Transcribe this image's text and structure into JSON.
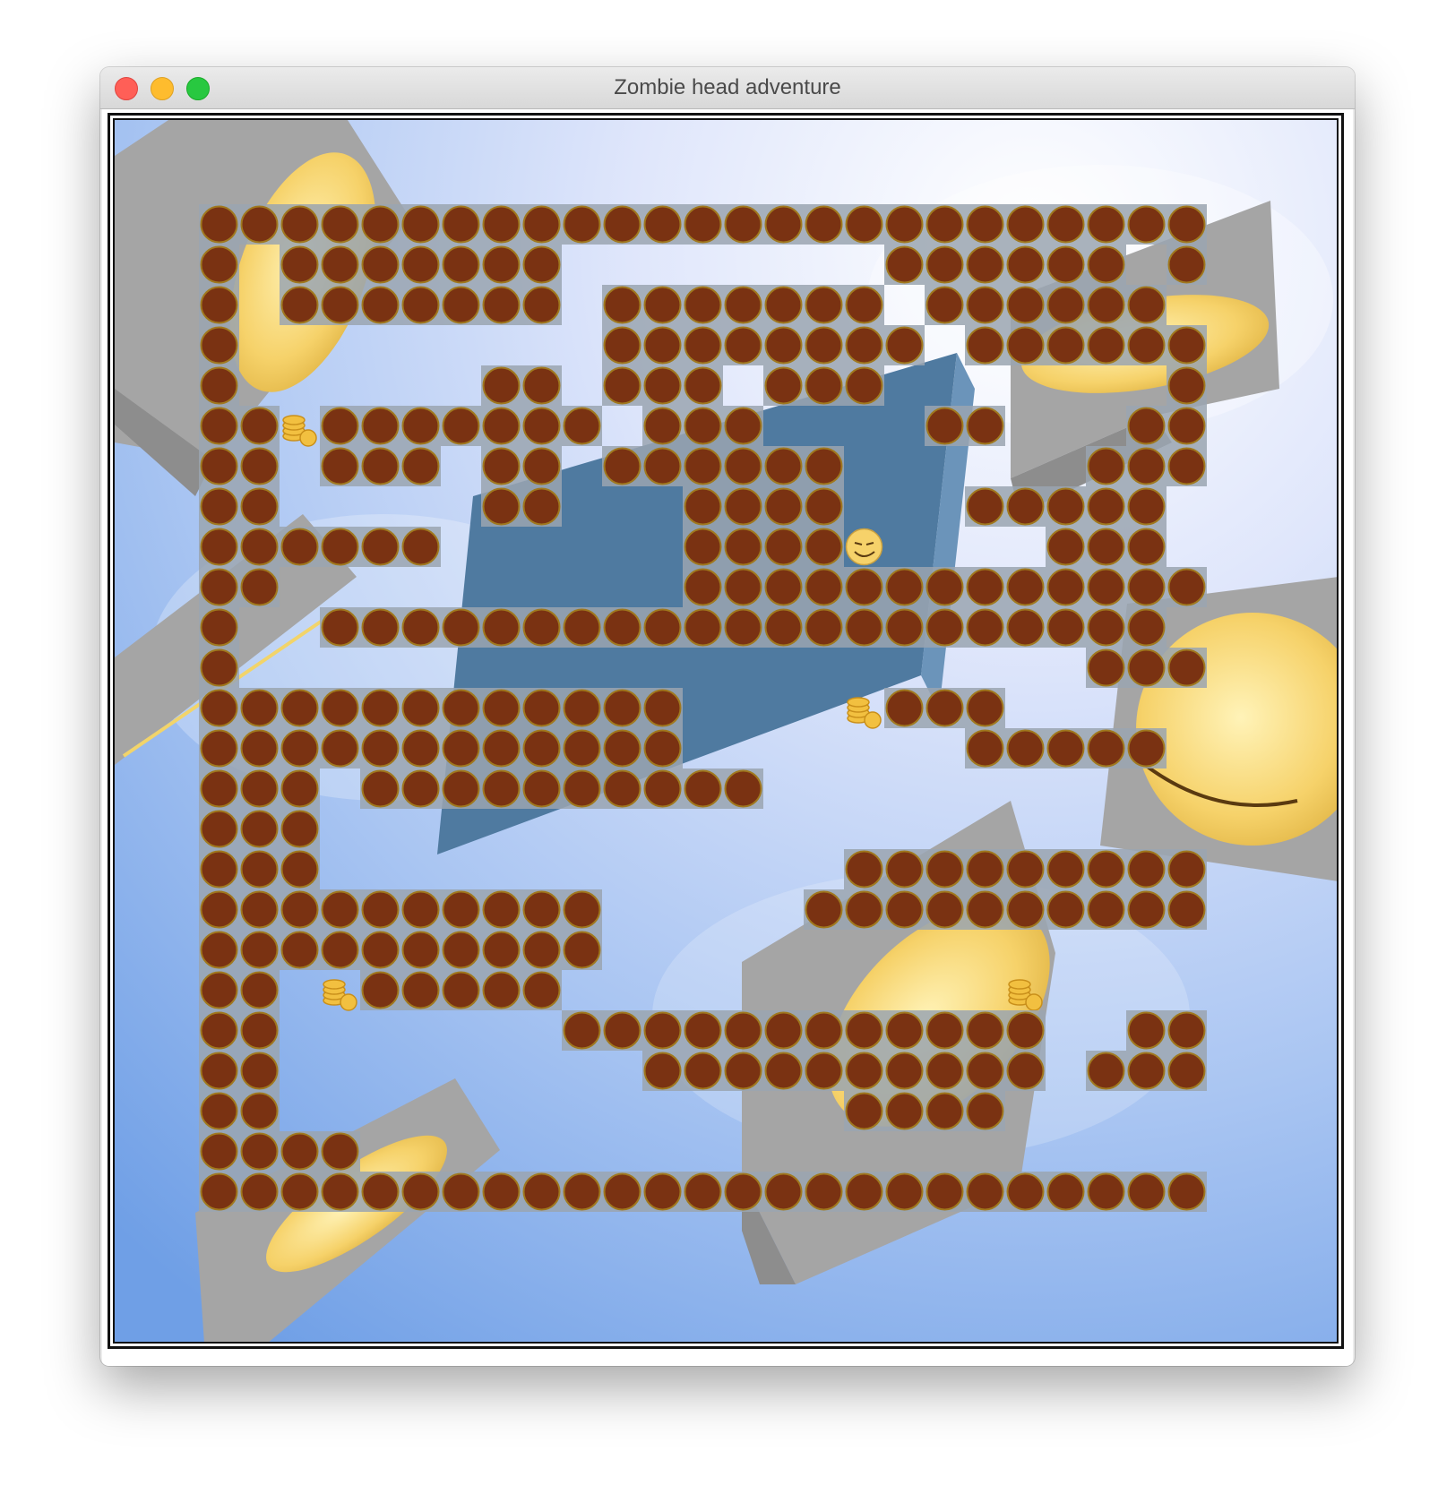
{
  "window": {
    "title": "Zombie head adventure"
  },
  "colors": {
    "sky_light": "#e8ecfb",
    "sky_blue": "#7aa8ea",
    "block_fill": "#7a3212",
    "block_ring": "#a0781e",
    "tile_bg": "#9aa4b0",
    "slab_blue": "#4f7aa0",
    "gray_block": "#a8a8a8",
    "smiley": "#f6d26a",
    "coin": "#f2c040"
  },
  "icons": {
    "player": "zombie-head-icon",
    "coin": "coin-stack-icon",
    "wall": "brown-ball-block-icon"
  },
  "maze": {
    "rows": [
      "1111111111111111111111111",
      "1.1111111........111111.1",
      "1.1111111.1111111.111111",
      "1.........11111111.111111",
      "1......11.111.111.......11",
      "11C1111111.111....11...11",
      "11.111.11.111111......111",
      "11.....11...1111...11111",
      "111111......1111P....111",
      "11..........11111111111111",
      "1..111111111111111111111",
      "1.....................111",
      "111111111111....C111.....1",
      "111111111111.......11111.1",
      "111.1111111111...........1",
      "111......................1",
      "111.............1111111111",
      "1111111111.....1111111111",
      "1111111111...............1",
      "11.C11111...........C....1",
      "11.......111111111111..111",
      "11.........1111111111.1111",
      "11..............1111.....1",
      "1111.....................1",
      "1111111111111111111111111"
    ]
  }
}
